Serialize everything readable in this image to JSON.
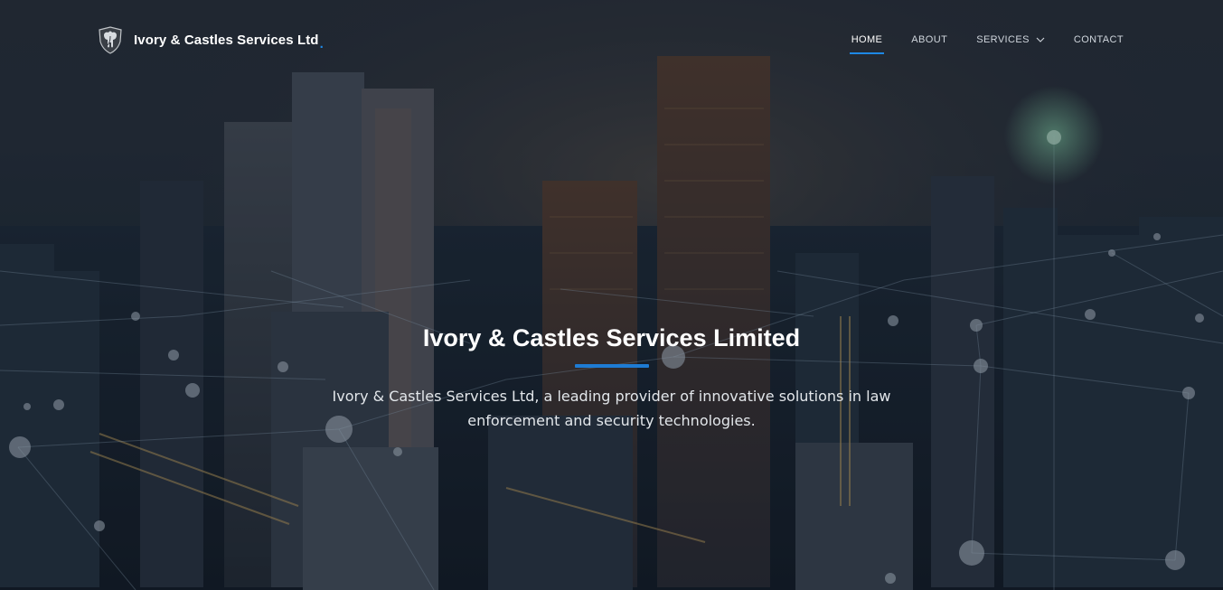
{
  "brand": {
    "logo_icon": "elephant-shield-icon",
    "name": "Ivory & Castles Services Ltd",
    "dot": "."
  },
  "nav": {
    "items": [
      {
        "label": "HOME",
        "active": true
      },
      {
        "label": "ABOUT",
        "active": false
      },
      {
        "label": "SERVICES",
        "active": false,
        "icon": "chevron-down-icon"
      },
      {
        "label": "CONTACT",
        "active": false
      }
    ]
  },
  "hero": {
    "title": "Ivory & Castles Services Limited",
    "subtitle": "Ivory & Castles Services Ltd, a leading provider of innovative solutions in law enforcement and security technologies.",
    "background": "city-skyline-network-image"
  },
  "colors": {
    "accent": "#1e88e5",
    "text": "#ffffff",
    "nav_text": "#d0d6dd"
  }
}
